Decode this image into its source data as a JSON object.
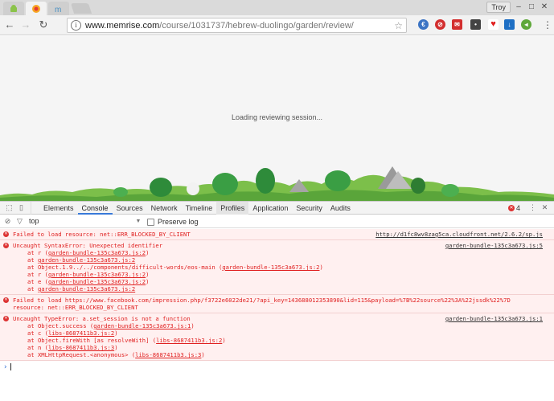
{
  "window": {
    "user": "Troy",
    "minimize": "–",
    "maximize": "□",
    "close": "✕"
  },
  "toolbar": {
    "back": "←",
    "forward": "→",
    "reload": "↻",
    "info": "i",
    "url_host": "www.memrise.com",
    "url_path": "/course/1031737/hebrew-duolingo/garden/review/",
    "star": "☆",
    "menu": "⋮"
  },
  "page": {
    "loading_text": "Loading reviewing session..."
  },
  "devtools": {
    "tabs": [
      "Elements",
      "Console",
      "Sources",
      "Network",
      "Timeline",
      "Profiles",
      "Application",
      "Security",
      "Audits"
    ],
    "active_tab": "Console",
    "error_count": "4",
    "filter": {
      "context": "top",
      "preserve_log": "Preserve log"
    },
    "messages": [
      {
        "text": "Failed to load resource: net::ERR_BLOCKED_BY_CLIENT",
        "source": "http://d1fc8wv8zag5ca.cloudfront.net/2.6.2/sp.js"
      },
      {
        "text": "Uncaught SyntaxError: Unexpected identifier",
        "source": "garden-bundle-135c3a673.js:5",
        "stack": [
          {
            "fn": "at r (",
            "link": "garden-bundle-135c3a673.js:2",
            "end": ")"
          },
          {
            "fn": "at ",
            "link": "garden-bundle-135c3a673.js:2",
            "end": ""
          },
          {
            "fn": "at Object.1.9../../components/difficult-words/eos-main (",
            "link": "garden-bundle-135c3a673.js:2",
            "end": ")"
          },
          {
            "fn": "at r (",
            "link": "garden-bundle-135c3a673.js:2",
            "end": ")"
          },
          {
            "fn": "at e (",
            "link": "garden-bundle-135c3a673.js:2",
            "end": ")"
          },
          {
            "fn": "at ",
            "link": "garden-bundle-135c3a673.js:2",
            "end": ""
          }
        ]
      },
      {
        "text": "Failed to load      https://www.facebook.com/impression.php/f3722e6022de21/?api_key=143688012353890&lid=115&payload=%7B%22source%22%3A%22jssdk%22%7D",
        "text2": "resource: net::ERR_BLOCKED_BY_CLIENT",
        "source": ""
      },
      {
        "text": "Uncaught TypeError: a.set_session is not a function",
        "source": "garden-bundle-135c3a673.js:1",
        "stack": [
          {
            "fn": "at Object.success (",
            "link": "garden-bundle-135c3a673.js:1",
            "end": ")"
          },
          {
            "fn": "at c (",
            "link": "libs-8687411b3.js:2",
            "end": ")"
          },
          {
            "fn": "at Object.fireWith [as resolveWith] (",
            "link": "libs-8687411b3.js:2",
            "end": ")"
          },
          {
            "fn": "at n (",
            "link": "libs-8687411b3.js:3",
            "end": ")"
          },
          {
            "fn": "at XMLHttpRequest.<anonymous> (",
            "link": "libs-8687411b3.js:3",
            "end": ")"
          }
        ]
      }
    ],
    "prompt": "›"
  },
  "colors": {
    "accent": "#3879d9",
    "error": "#e02020",
    "error_bg": "#fff0f0"
  }
}
